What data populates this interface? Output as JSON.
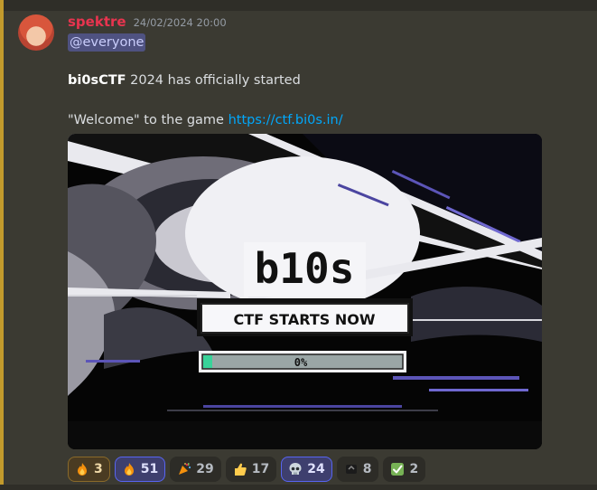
{
  "message": {
    "username": "spektre",
    "timestamp": "24/02/2024 20:00",
    "mention": "@everyone",
    "line1_bold": "bi0sCTF",
    "line1_rest": " 2024 has officially started",
    "line2_text": "\"Welcome\" to the game ",
    "line2_link": "https://ctf.bi0s.in/"
  },
  "embed": {
    "logo_text": "b10s",
    "banner_text": "CTF STARTS NOW",
    "progress_label": "0%",
    "progress_fraction": 0.0
  },
  "reactions": [
    {
      "icon": "flame-icon",
      "count": "3"
    },
    {
      "icon": "flame-icon",
      "count": "51"
    },
    {
      "icon": "party-popper-icon",
      "count": "29"
    },
    {
      "icon": "thumbs-up-icon",
      "count": "17"
    },
    {
      "icon": "skull-icon",
      "count": "24"
    },
    {
      "icon": "bi0s-emoji-icon",
      "count": "8"
    },
    {
      "icon": "check-mark-icon",
      "count": "2"
    }
  ],
  "colors": {
    "username": "#e8344f",
    "mention_bg": "#4f5281",
    "link": "#00a8fc",
    "mention_highlight_bar": "#c29a2c"
  }
}
